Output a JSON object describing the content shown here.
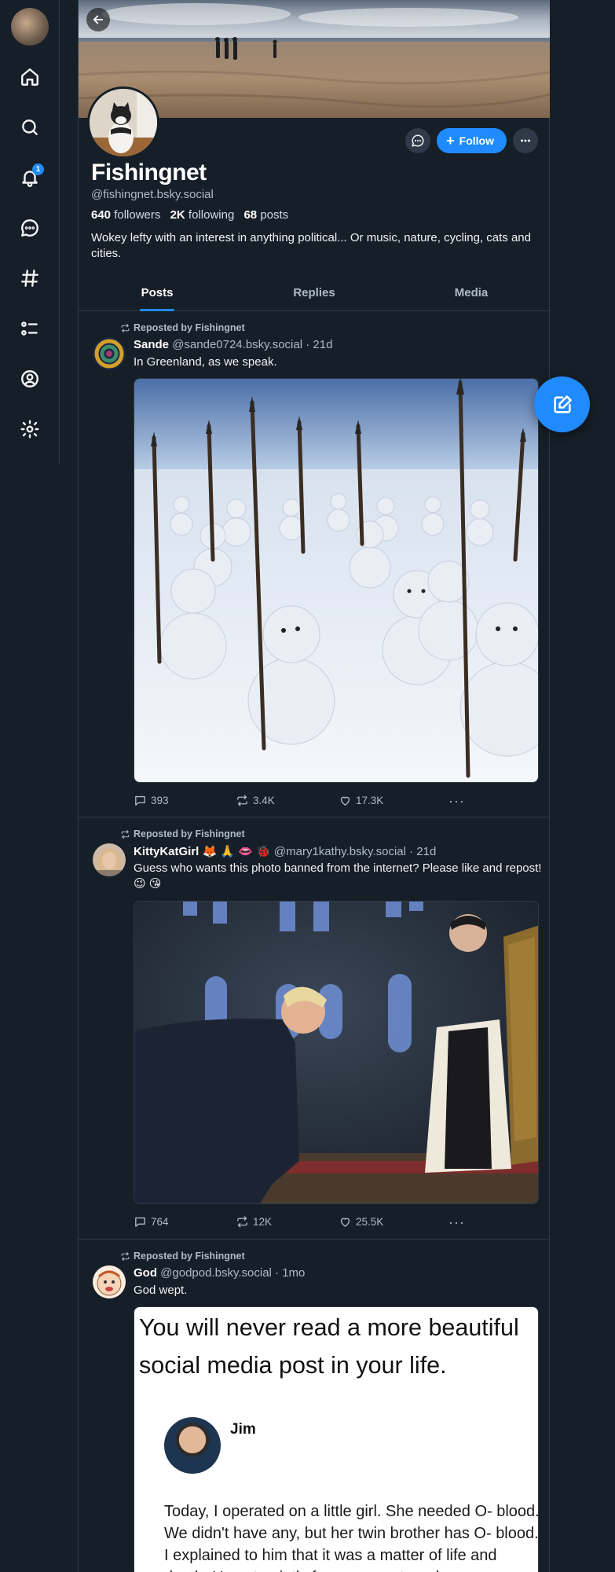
{
  "nav": {
    "items": [
      {
        "name": "home",
        "icon": "home-icon"
      },
      {
        "name": "search",
        "icon": "search-icon"
      },
      {
        "name": "notifications",
        "icon": "bell-icon",
        "badge": "1"
      },
      {
        "name": "chat",
        "icon": "chat-icon"
      },
      {
        "name": "feeds",
        "icon": "hash-icon"
      },
      {
        "name": "lists",
        "icon": "list-icon"
      },
      {
        "name": "profile",
        "icon": "user-icon"
      },
      {
        "name": "settings",
        "icon": "gear-icon"
      }
    ]
  },
  "profile": {
    "display_name": "Fishingnet",
    "handle": "@fishingnet.bsky.social",
    "followers_count": "640",
    "followers_label": "followers",
    "following_count": "2K",
    "following_label": "following",
    "posts_count": "68",
    "posts_label": "posts",
    "bio": "Wokey lefty with an interest in anything political... Or music, nature, cycling, cats and cities.",
    "follow_label": "Follow"
  },
  "tabs": [
    "Posts",
    "Replies",
    "Media"
  ],
  "active_tab": "Posts",
  "posts": [
    {
      "repost_label": "Reposted by Fishingnet",
      "author": "Sande",
      "handle": "@sande0724.bsky.social",
      "time": "· 21d",
      "text": "In Greenland, as we speak.",
      "replies": "393",
      "reposts": "3.4K",
      "likes": "17.3K"
    },
    {
      "repost_label": "Reposted by Fishingnet",
      "author": "KittyKatGirl 🦊 🙏 👄 🐞",
      "handle": "@mary1kathy.bsky.social",
      "time": "· 21d",
      "text": "Guess who wants this photo banned from the internet? Please like and repost! 😉 😘",
      "replies": "764",
      "reposts": "12K",
      "likes": "25.5K"
    },
    {
      "repost_label": "Reposted by Fishingnet",
      "author": "God",
      "handle": "@godpod.bsky.social",
      "time": "· 1mo",
      "text": "God wept.",
      "image_text": {
        "title": "You will never read a more beautiful social media post in your life.",
        "name": "Jim",
        "body": "Today, I operated on a little girl. She needed O- blood. We didn't have any, but her twin brother has O- blood. I explained to him that it was a matter of life and death. He sat quietly for a moment, and"
      }
    }
  ],
  "colors": {
    "background": "#161e27",
    "accent": "#208bfe",
    "border": "#2e3a47",
    "muted_text": "#aebbc9"
  }
}
